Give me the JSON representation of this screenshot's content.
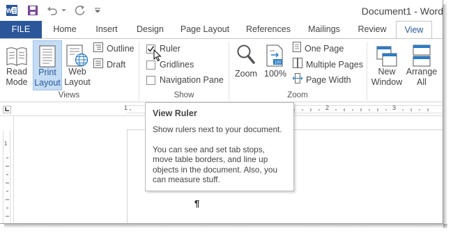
{
  "title_bar": {
    "document_title": "Document1 - Word",
    "quick_access": [
      "word-logo-icon",
      "save-icon",
      "undo-icon",
      "undo-dropdown-icon",
      "redo-icon",
      "customize-toolbar-icon"
    ]
  },
  "tabs": [
    {
      "label": "FILE"
    },
    {
      "label": "Home"
    },
    {
      "label": "Insert"
    },
    {
      "label": "Design"
    },
    {
      "label": "Page Layout"
    },
    {
      "label": "References"
    },
    {
      "label": "Mailings"
    },
    {
      "label": "Review"
    },
    {
      "label": "View"
    }
  ],
  "active_tab": "View",
  "ribbon": {
    "views": {
      "label": "Views",
      "read_mode": "Read Mode",
      "read_mode_l1": "Read",
      "read_mode_l2": "Mode",
      "print_layout_l1": "Print",
      "print_layout_l2": "Layout",
      "web_layout_l1": "Web",
      "web_layout_l2": "Layout",
      "outline": "Outline",
      "draft": "Draft"
    },
    "show": {
      "label": "Show",
      "ruler": "Ruler",
      "gridlines": "Gridlines",
      "navigation_pane": "Navigation Pane",
      "ruler_checked": true,
      "gridlines_checked": false,
      "navigation_pane_checked": false
    },
    "zoom": {
      "label": "Zoom",
      "zoom_btn": "Zoom",
      "hundred": "100%",
      "one_page": "One Page",
      "multiple_pages": "Multiple Pages",
      "page_width": "Page Width"
    },
    "window": {
      "new_window_l1": "New",
      "new_window_l2": "Window",
      "arrange_all_l1": "Arrange",
      "arrange_all_l2": "All"
    }
  },
  "ruler": {
    "h_numbers": [
      "1",
      "2",
      "3"
    ],
    "v_numbers": [
      "1"
    ]
  },
  "tooltip": {
    "title": "View Ruler",
    "p1": "Show rulers next to your document.",
    "p2": "You can see and set tab stops, move table borders, and line up objects in the document. Also, you can measure stuff."
  },
  "document": {
    "paragraph_mark": "¶"
  },
  "colors": {
    "accent": "#2b579a",
    "active_button": "#c5dcf4"
  }
}
